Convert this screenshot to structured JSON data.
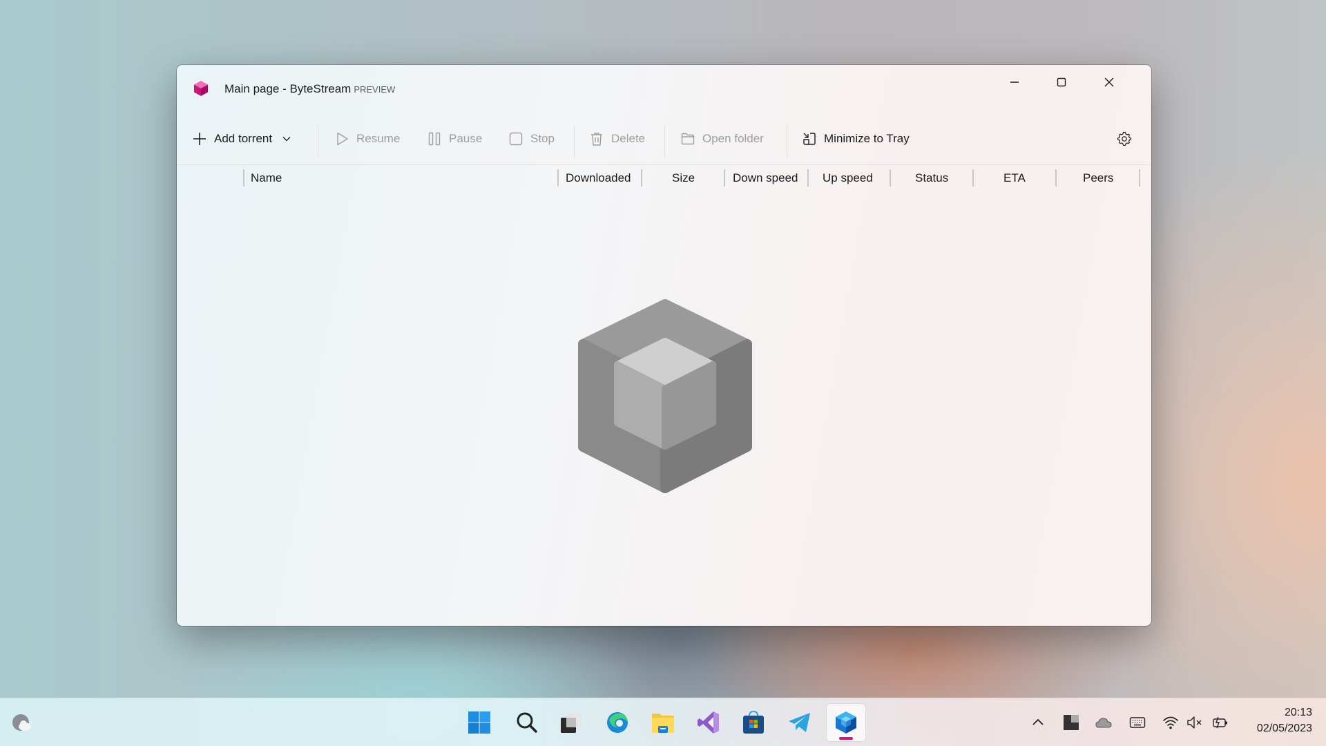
{
  "window": {
    "title": "Main page - ByteStream",
    "title_badge": "PREVIEW",
    "controls": [
      "minimize",
      "maximize",
      "close"
    ]
  },
  "toolbar": {
    "add_torrent": "Add torrent",
    "resume": "Resume",
    "pause": "Pause",
    "stop": "Stop",
    "delete": "Delete",
    "open_folder": "Open folder",
    "minimize_to_tray": "Minimize to Tray",
    "disabled_items": [
      "Resume",
      "Pause",
      "Stop",
      "Delete",
      "Open folder"
    ]
  },
  "table": {
    "columns": [
      "Name",
      "Downloaded",
      "Size",
      "Down speed",
      "Up speed",
      "Status",
      "ETA",
      "Peers"
    ],
    "rows": []
  },
  "empty_state": {
    "icon": "cube-icon"
  },
  "taskbar": {
    "apps": [
      {
        "name": "start",
        "icon": "windows-start-icon"
      },
      {
        "name": "search",
        "icon": "search-icon"
      },
      {
        "name": "task-view",
        "icon": "task-view-icon"
      },
      {
        "name": "edge",
        "icon": "edge-browser-icon"
      },
      {
        "name": "file-explorer",
        "icon": "folder-icon"
      },
      {
        "name": "visual-studio",
        "icon": "visual-studio-icon"
      },
      {
        "name": "microsoft-store",
        "icon": "store-icon"
      },
      {
        "name": "telegram",
        "icon": "telegram-icon"
      },
      {
        "name": "bytestream",
        "icon": "bytestream-icon",
        "active": true
      }
    ],
    "tray": [
      "chevron-up-icon",
      "app-tray-icon",
      "onedrive-cloud-icon",
      "keyboard-icon",
      "wifi-icon",
      "volume-muted-icon",
      "battery-charging-icon"
    ],
    "time": "20:13",
    "date": "02/05/2023"
  },
  "colors": {
    "accent": "#d4157f",
    "app_icon": "#c8157a",
    "disabled_text": "#9e9e9e"
  }
}
